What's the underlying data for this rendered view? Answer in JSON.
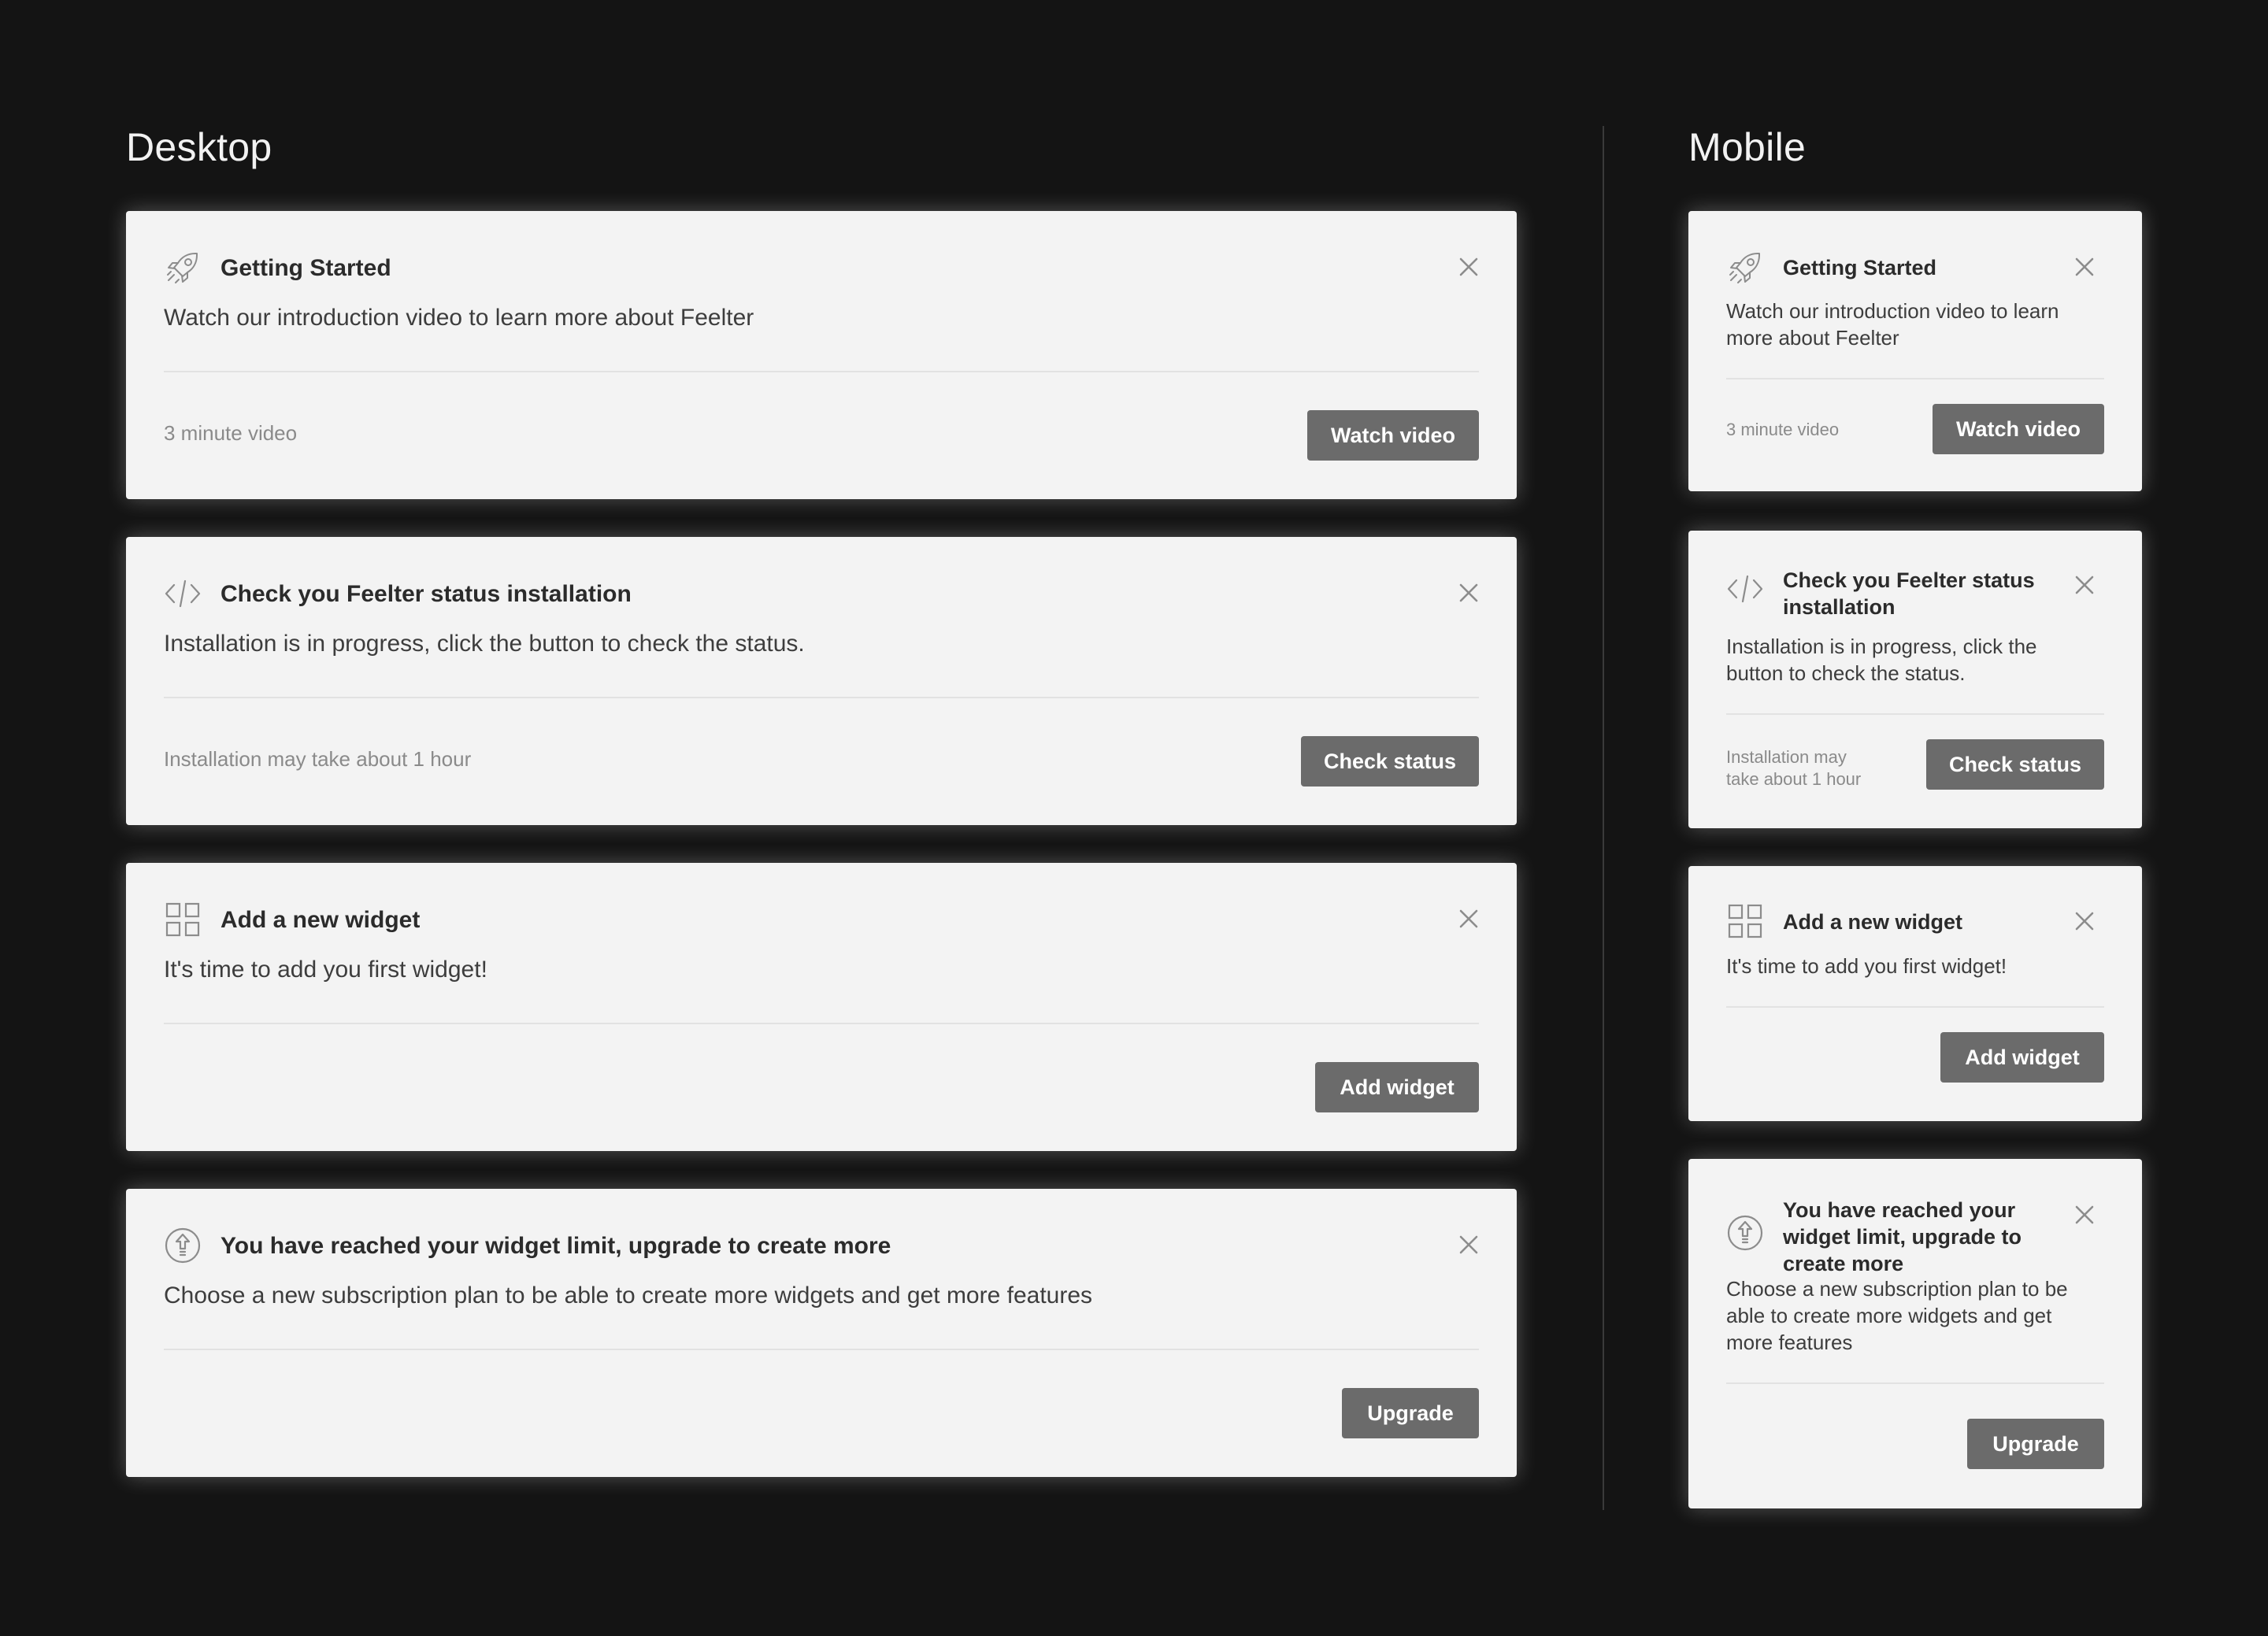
{
  "desktop": {
    "heading": "Desktop",
    "cards": [
      {
        "icon": "rocket-icon",
        "title": "Getting Started",
        "description": "Watch our introduction video to learn more about Feelter",
        "meta": "3 minute video",
        "button": "Watch video"
      },
      {
        "icon": "code-icon",
        "title": "Check you Feelter status installation",
        "description": "Installation is in progress, click the button to check the status.",
        "meta": "Installation may take about 1 hour",
        "button": "Check status"
      },
      {
        "icon": "grid-icon",
        "title": "Add a new widget",
        "description": "It's time to add you first widget!",
        "meta": "",
        "button": "Add widget"
      },
      {
        "icon": "upgrade-icon",
        "title": "You have reached your widget limit, upgrade to create more",
        "description": "Choose a new subscription plan to be able to create more widgets and get more features",
        "meta": "",
        "button": "Upgrade"
      }
    ]
  },
  "mobile": {
    "heading": "Mobile",
    "cards": [
      {
        "icon": "rocket-icon",
        "title": "Getting Started",
        "description": "Watch our introduction video to learn more about Feelter",
        "meta": "3 minute video",
        "button": "Watch video"
      },
      {
        "icon": "code-icon",
        "title": "Check you Feelter status installation",
        "description": "Installation is in progress, click the button to check the status.",
        "meta": "Installation may take about 1 hour",
        "button": "Check status"
      },
      {
        "icon": "grid-icon",
        "title": "Add a new widget",
        "description": "It's time to add you first widget!",
        "meta": "",
        "button": "Add widget"
      },
      {
        "icon": "upgrade-icon",
        "title": "You have reached your widget limit, upgrade to create more",
        "description": "Choose a new subscription plan to be able to create more widgets and get more features",
        "meta": "",
        "button": "Upgrade"
      }
    ]
  },
  "colors": {
    "background": "#141414",
    "card": "#f3f3f3",
    "button": "#6b6b6b",
    "title_text": "#2b2b2b",
    "meta_text": "#8a8a8a"
  }
}
